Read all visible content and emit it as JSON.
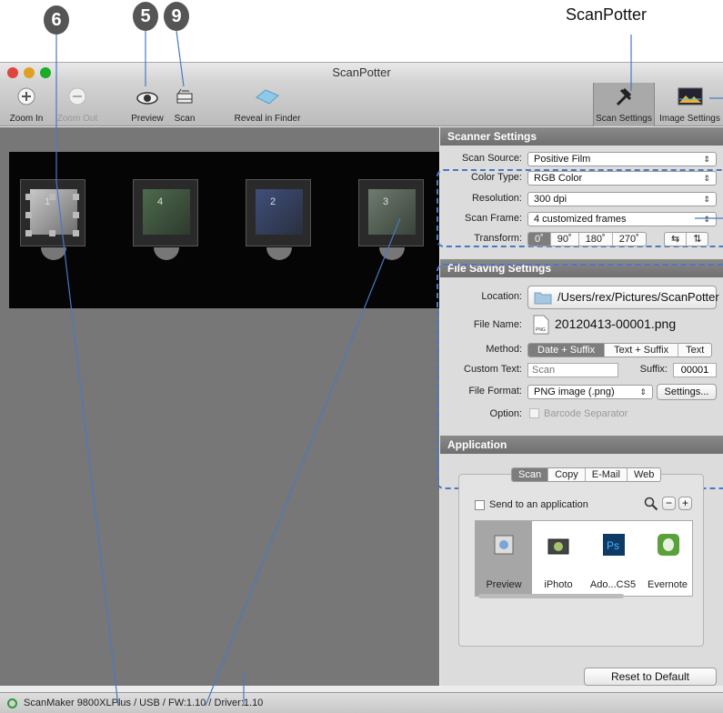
{
  "callouts": {
    "six": "6",
    "five": "5",
    "nine": "9",
    "scanpotter_label": "ScanPotter"
  },
  "window": {
    "title": "ScanPotter"
  },
  "toolbar": {
    "zoom_in": "Zoom In",
    "zoom_out": "Zoom Out",
    "preview": "Preview",
    "scan": "Scan",
    "reveal": "Reveal in Finder",
    "scan_settings": "Scan Settings",
    "image_settings": "Image Settings"
  },
  "frames": [
    "1",
    "4",
    "2",
    "3"
  ],
  "scanner_settings": {
    "header": "Scanner Settings",
    "scan_source_label": "Scan Source:",
    "scan_source": "Positive Film",
    "color_type_label": "Color Type:",
    "color_type": "RGB Color",
    "resolution_label": "Resolution:",
    "resolution": "300 dpi",
    "scan_frame_label": "Scan Frame:",
    "scan_frame": "4 customized frames",
    "transform_label": "Transform:",
    "transform_options": [
      "0˚",
      "90˚",
      "180˚",
      "270˚"
    ]
  },
  "file_saving": {
    "header": "File Saving Settings",
    "location_label": "Location:",
    "location": "/Users/rex/Pictures/ScanPotter",
    "file_name_label": "File Name:",
    "file_name": "20120413-00001.png",
    "method_label": "Method:",
    "methods": [
      "Date + Suffix",
      "Text + Suffix",
      "Text"
    ],
    "custom_text_label": "Custom Text:",
    "custom_text_placeholder": "Scan",
    "suffix_label": "Suffix:",
    "suffix": "00001",
    "file_format_label": "File Format:",
    "file_format": "PNG image (.png)",
    "settings_button": "Settings...",
    "option_label": "Option:",
    "barcode_label": "Barcode Separator"
  },
  "application": {
    "header": "Application",
    "tabs": [
      "Scan",
      "Copy",
      "E-Mail",
      "Web"
    ],
    "send_label": "Send to an application",
    "apps": [
      "Preview",
      "iPhoto",
      "Ado...CS5",
      "Evernote"
    ]
  },
  "reset_button": "Reset to Default",
  "status": "ScanMaker 9800XLPlus / USB / FW:1.10 / Driver:1.10"
}
